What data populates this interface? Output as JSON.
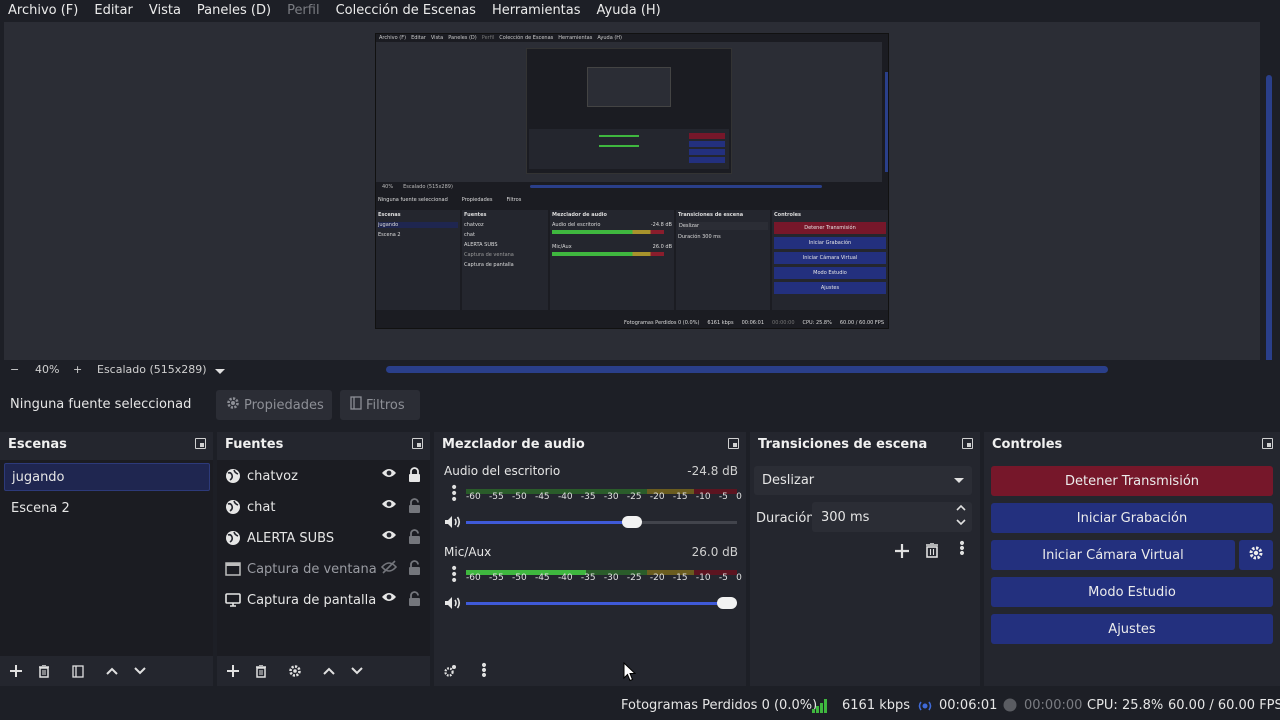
{
  "menu": [
    "Archivo (F)",
    "Editar",
    "Vista",
    "Paneles (D)",
    "Perfil",
    "Colección de Escenas",
    "Herramientas",
    "Ayuda (H)"
  ],
  "menu_disabled_index": 4,
  "preview": {
    "mini_menu": [
      "Archivo (F)",
      "Editar",
      "Vista",
      "Paneles (D)",
      "Perfil",
      "Colección de Escenas",
      "Herramientas",
      "Ayuda (H)"
    ],
    "mini_zoom": "40%",
    "mini_scaled": "Escalado (515x289)",
    "mini_no_source": "Ninguna fuente seleccionad",
    "mini_props": "Propiedades",
    "mini_filters": "Filtros",
    "mini_scenes_title": "Escenas",
    "mini_scenes": [
      "jugando",
      "Escena 2"
    ],
    "mini_sources_title": "Fuentes",
    "mini_sources": [
      "chatvoz",
      "chat",
      "ALERTA SUBS",
      "Captura de ventana",
      "Captura de pantalla"
    ],
    "mini_mixer_title": "Mezclador de audio",
    "mini_ch1": "Audio del escritorio",
    "mini_ch1_db": "-24.8 dB",
    "mini_ch2": "Mic/Aux",
    "mini_ch2_db": "26.0 dB",
    "mini_trans_title": "Transiciones de escena",
    "mini_trans": "Deslizar",
    "mini_dur_label": "Duración",
    "mini_dur": "300 ms",
    "mini_controls_title": "Controles",
    "mini_controls": [
      "Detener Transmisión",
      "Iniciar Grabación",
      "Iniciar Cámara Virtual",
      "Modo Estudio",
      "Ajustes"
    ],
    "mini_status": [
      "Fotogramas Perdidos 0 (0.0%)",
      "6161 kbps",
      "00:06:01",
      "00:00:00",
      "CPU: 25.8%",
      "60.00 / 60.00 FPS"
    ]
  },
  "zoombar": {
    "minus": "−",
    "zoom": "40%",
    "plus": "+",
    "scaled": "Escalado (515x289)"
  },
  "props": {
    "no_source": "Ninguna fuente seleccionad",
    "properties": "Propiedades",
    "filters": "Filtros"
  },
  "scenes": {
    "title": "Escenas",
    "items": [
      "jugando",
      "Escena 2"
    ],
    "selected_index": 0
  },
  "sources": {
    "title": "Fuentes",
    "items": [
      {
        "name": "chatvoz",
        "icon": "globe-icon",
        "visible": true,
        "locked": true
      },
      {
        "name": "chat",
        "icon": "globe-icon",
        "visible": true,
        "locked": false
      },
      {
        "name": "ALERTA SUBS",
        "icon": "globe-icon",
        "visible": true,
        "locked": false
      },
      {
        "name": "Captura de ventana",
        "icon": "window-capture-icon",
        "visible": false,
        "locked": false
      },
      {
        "name": "Captura de pantalla",
        "icon": "monitor-icon",
        "visible": true,
        "locked": false
      }
    ]
  },
  "mixer": {
    "title": "Mezclador de audio",
    "scale": [
      "-60",
      "-55",
      "-50",
      "-45",
      "-40",
      "-35",
      "-30",
      "-25",
      "-20",
      "-15",
      "-10",
      "-5",
      "0"
    ],
    "channels": [
      {
        "name": "Audio del escritorio",
        "db": "-24.8 dB",
        "volume": 0.62,
        "level": 0.0
      },
      {
        "name": "Mic/Aux",
        "db": "26.0 dB",
        "volume": 1.0,
        "level": 0.45
      }
    ]
  },
  "transitions": {
    "title": "Transiciones de escena",
    "selected": "Deslizar",
    "duration_label": "Duración",
    "duration": "300 ms"
  },
  "controls": {
    "title": "Controles",
    "stop_stream": "Detener Transmisión",
    "start_recording": "Iniciar Grabación",
    "start_virtualcam": "Iniciar Cámara Virtual",
    "studio_mode": "Modo Estudio",
    "settings": "Ajustes"
  },
  "status": {
    "dropped": "Fotogramas Perdidos 0 (0.0%)",
    "bitrate": "6161 kbps",
    "stream_time": "00:06:01",
    "rec_time": "00:00:00",
    "cpu": "CPU: 25.8%",
    "fps": "60.00 / 60.00 FPS"
  },
  "colors": {
    "accent_blue": "#23307e",
    "stop_red": "#76172a",
    "meter_green": "#3fb73f",
    "meter_yellow": "#a8932c",
    "meter_red": "#8a1d2c",
    "selection": "#1f2650"
  }
}
